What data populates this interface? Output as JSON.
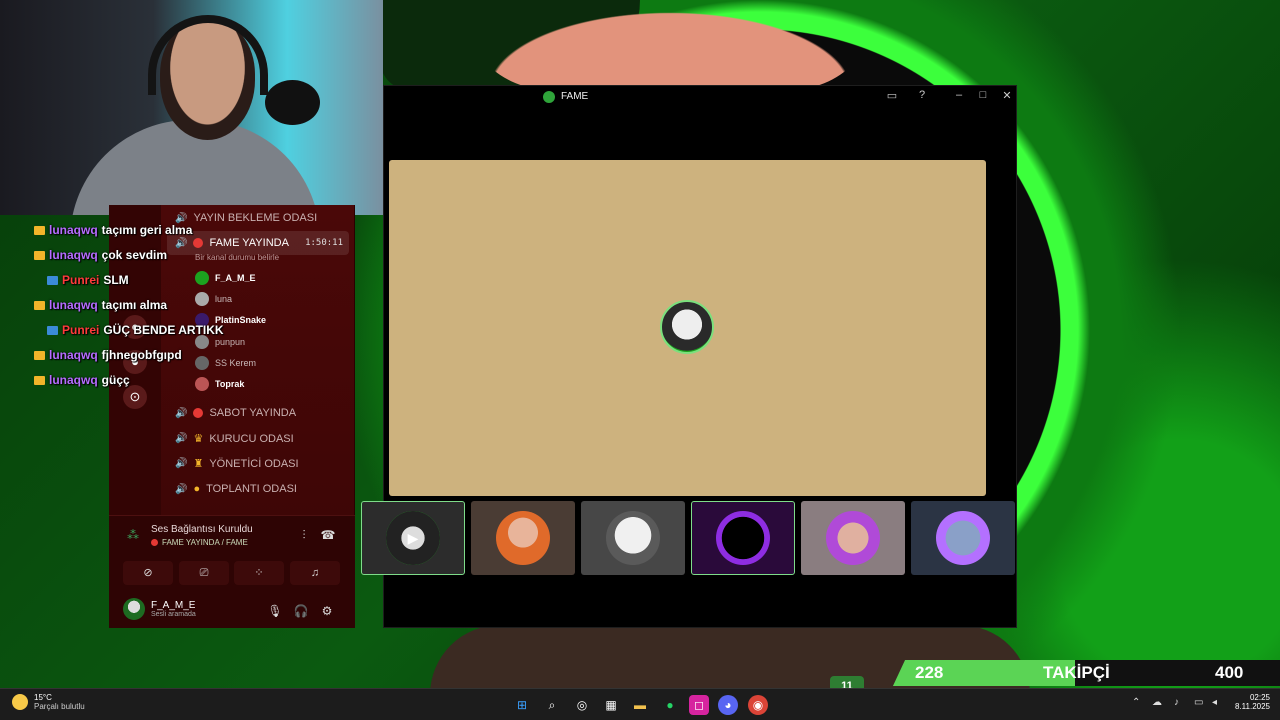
{
  "chat": [
    {
      "user": "lunaqwq",
      "msg": "taçımı geri alma",
      "color": "#b56cff"
    },
    {
      "user": "lunaqwq",
      "msg": "çok sevdim",
      "color": "#b56cff"
    },
    {
      "user": "Punrei",
      "msg": "SLM",
      "color": "#ff3b3b"
    },
    {
      "user": "lunaqwq",
      "msg": "taçımı alma",
      "color": "#b56cff"
    },
    {
      "user": "Punrei",
      "msg": "GÜÇ BENDE ARTIKK",
      "color": "#ff3b3b"
    },
    {
      "user": "lunaqwq",
      "msg": "fjhnegobfgıpd",
      "color": "#b56cff"
    },
    {
      "user": "lunaqwq",
      "msg": "güçç",
      "color": "#b56cff"
    }
  ],
  "discord": {
    "channels": {
      "waiting": "YAYIN BEKLEME ODASI",
      "active": "FAME YAYINDA",
      "active_timer": "1:50:11",
      "status_hint": "Bir kanal durumu belirle",
      "sabot": "SABOT YAYINDA",
      "kurucu": "KURUCU ODASI",
      "yonetici": "YÖNETİCİ ODASI",
      "toplanti": "TOPLANTI ODASI"
    },
    "members": [
      "F_A_M_E",
      "luna",
      "PlatinSnake",
      "punpun",
      "SS Kerem",
      "Toprak"
    ],
    "voice": {
      "status": "Ses Bağlantısı Kuruldu",
      "channel": "FAME YAYINDA / FAME"
    },
    "user": {
      "name": "F_A_M_E",
      "sub": "Sesli aramada"
    }
  },
  "window": {
    "title": "FAME"
  },
  "followers": {
    "current": "228",
    "label": "TAKİPÇİ",
    "goal": "400"
  },
  "taskbar": {
    "temp": "15°C",
    "condition": "Parçalı bulutlu",
    "time": "02:25",
    "date": "8.11.2025",
    "badge": "11"
  },
  "colors": {
    "accent_green": "#5bd455",
    "discord_red": "#4a0808",
    "stage_bg": "#cdb27e"
  }
}
